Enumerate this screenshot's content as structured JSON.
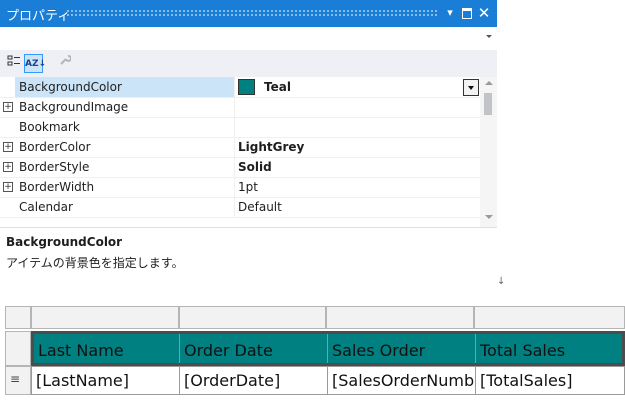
{
  "window": {
    "title": "プロパティ",
    "close_glyph": "✕",
    "dropdown_glyph": "▾"
  },
  "toolbar": {
    "categorized_icon": "categorized-icon",
    "alphabetical_label": "AZ↓",
    "property_pages_icon": "wrench-icon"
  },
  "properties": [
    {
      "name": "BackgroundColor",
      "value": "Teal",
      "expandable": false,
      "selected": true,
      "bold": true,
      "swatch": "#008080"
    },
    {
      "name": "BackgroundImage",
      "value": "",
      "expandable": true,
      "selected": false,
      "bold": false
    },
    {
      "name": "Bookmark",
      "value": "",
      "expandable": false,
      "selected": false,
      "bold": false
    },
    {
      "name": "BorderColor",
      "value": "LightGrey",
      "expandable": true,
      "selected": false,
      "bold": true
    },
    {
      "name": "BorderStyle",
      "value": "Solid",
      "expandable": true,
      "selected": false,
      "bold": true
    },
    {
      "name": "BorderWidth",
      "value": "1pt",
      "expandable": true,
      "selected": false,
      "bold": false
    },
    {
      "name": "Calendar",
      "value": "Default",
      "expandable": false,
      "selected": false,
      "bold": false
    }
  ],
  "description": {
    "title": "BackgroundColor",
    "text": "アイテムの背景色を指定します。"
  },
  "report": {
    "header_color": "#008080",
    "columns": [
      "Last Name",
      "Order Date",
      "Sales Order",
      "Total Sales"
    ],
    "row_fields": [
      "[LastName]",
      "[OrderDate]",
      "[SalesOrderNumber]",
      "[TotalSales]"
    ],
    "row_handle_glyph": "≡"
  }
}
